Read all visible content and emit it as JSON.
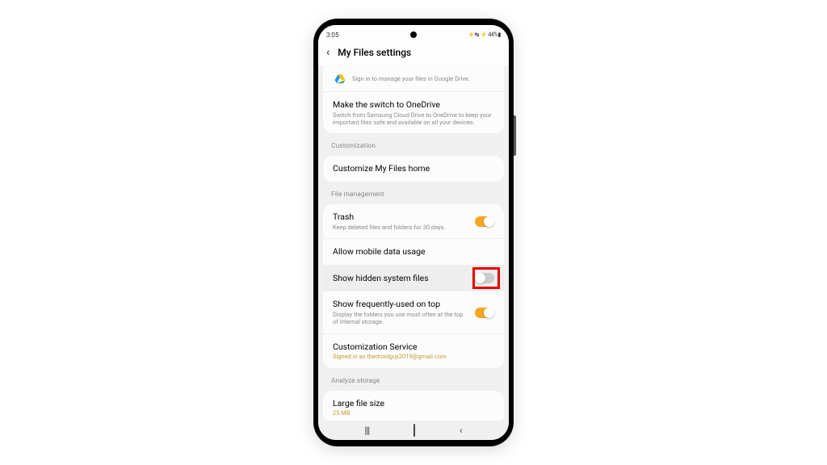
{
  "statusBar": {
    "time": "3:05",
    "right": "⚡↹ ⚡ 44%▮"
  },
  "header": {
    "title": "My Files settings"
  },
  "topPartial": {
    "title": "Google Drive",
    "sub": "Sign in to manage your files in Google Drive."
  },
  "onedrive": {
    "title": "Make the switch to OneDrive",
    "sub": "Switch from Samsung Cloud Drive to OneDrive to keep your important files safe and available on all your devices."
  },
  "sections": {
    "customization": "Customization",
    "fileManagement": "File management",
    "analyzeStorage": "Analyze storage"
  },
  "customize": {
    "title": "Customize My Files home"
  },
  "trash": {
    "title": "Trash",
    "sub": "Keep deleted files and folders for 30 days."
  },
  "mobileData": {
    "title": "Allow mobile data usage"
  },
  "hiddenFiles": {
    "title": "Show hidden system files"
  },
  "frequentlyUsed": {
    "title": "Show frequently-used on top",
    "sub": "Display the folders you use most often at the top of Internal storage."
  },
  "customizationService": {
    "title": "Customization Service",
    "sub": "Signed in as thedroidguy2019@gmail.com"
  },
  "largeFile": {
    "title": "Large file size",
    "sub": "25 MB"
  }
}
